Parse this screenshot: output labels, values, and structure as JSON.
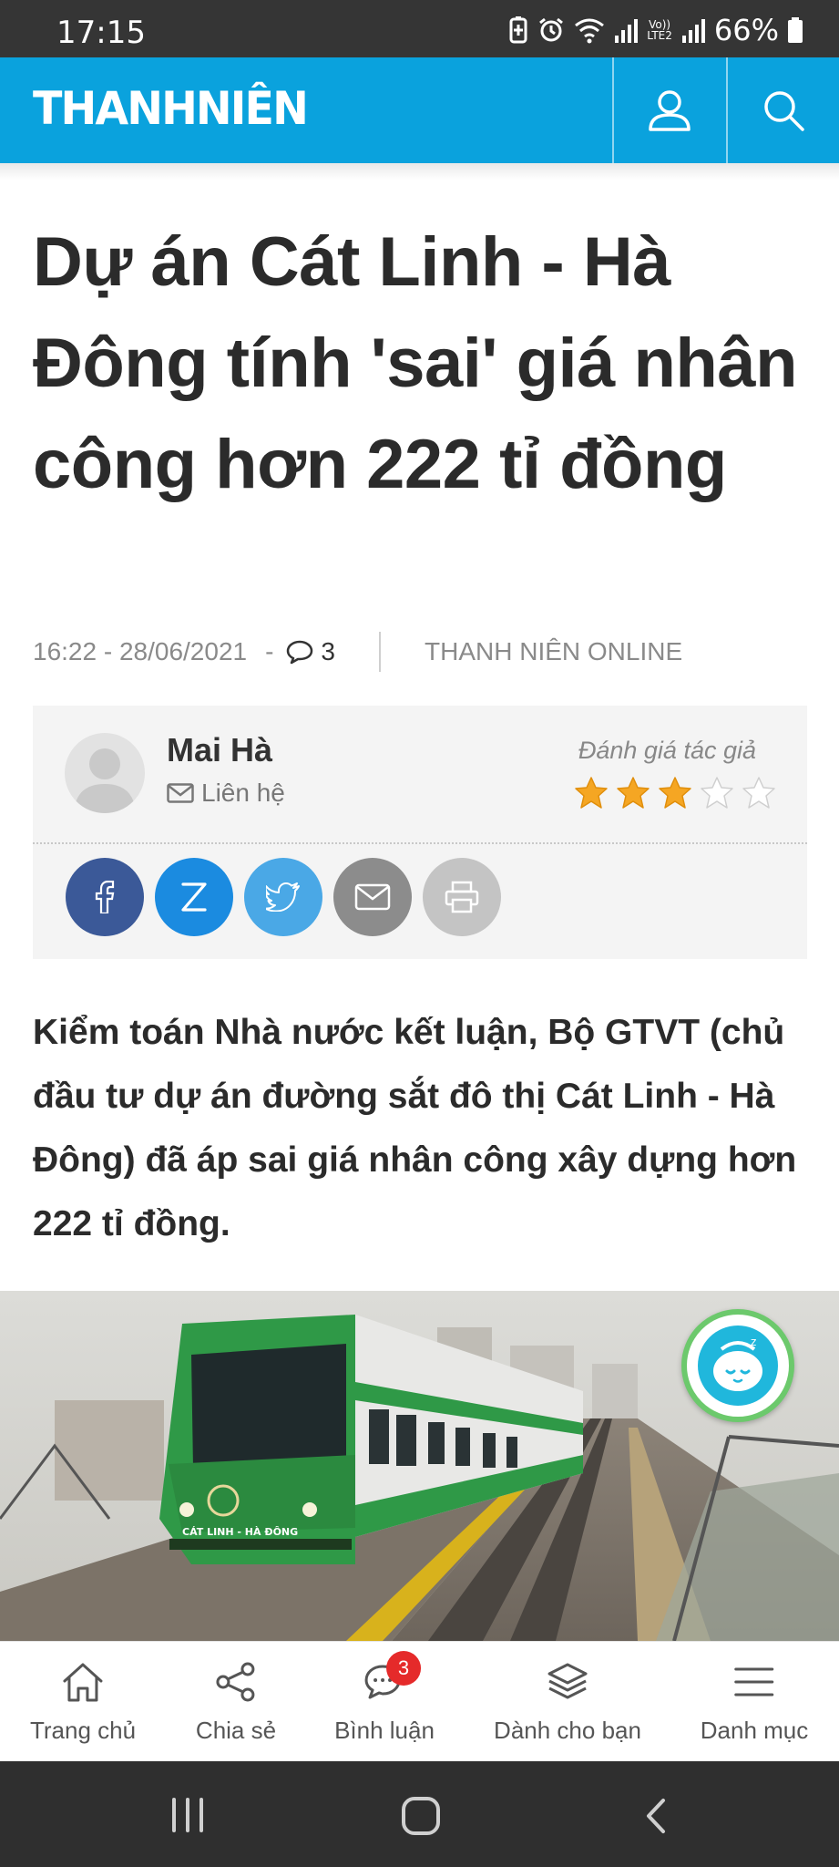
{
  "status_bar": {
    "time": "17:15",
    "network": "Vo))\nLTE2",
    "battery": "66%"
  },
  "header": {
    "logo": "THANHNIÊN"
  },
  "article": {
    "title": "Dự án Cát Linh - Hà Đông tính 'sai' giá nhân công hơn 222 tỉ đồng",
    "datetime": "16:22 - 28/06/2021",
    "separator": "-",
    "comment_count": "3",
    "source": "THANH NIÊN ONLINE",
    "lead": "Kiểm toán Nhà nước kết luận, Bộ GTVT (chủ đầu tư dự án đường sắt đô thị Cát Linh - Hà Đông) đã áp sai giá nhân công xây dựng hơn 222 tỉ đồng."
  },
  "author": {
    "name": "Mai Hà",
    "contact_label": "Liên hệ",
    "rating_label": "Đánh giá tác giả",
    "rating": 3,
    "rating_max": 5
  },
  "share_buttons": [
    {
      "icon": "facebook-icon",
      "color": "#3b5998"
    },
    {
      "icon": "zalo-icon",
      "color": "#1b8be0"
    },
    {
      "icon": "twitter-icon",
      "color": "#4aa8e6"
    },
    {
      "icon": "email-icon",
      "color": "#8c8c8c"
    },
    {
      "icon": "print-icon",
      "color": "#c4c4c4"
    }
  ],
  "image": {
    "train_label": "CÁT LINH - HÀ ĐÔNG"
  },
  "bottom_nav": {
    "items": [
      {
        "label": "Trang chủ",
        "icon": "home-icon"
      },
      {
        "label": "Chia sẻ",
        "icon": "share-icon"
      },
      {
        "label": "Bình luận",
        "icon": "comment-icon",
        "badge": "3"
      },
      {
        "label": "Dành cho bạn",
        "icon": "layers-icon"
      },
      {
        "label": "Danh mục",
        "icon": "menu-icon"
      }
    ]
  },
  "colors": {
    "brand": "#0aa2dd",
    "star": "#f5a623",
    "badge": "#e52a2a"
  }
}
